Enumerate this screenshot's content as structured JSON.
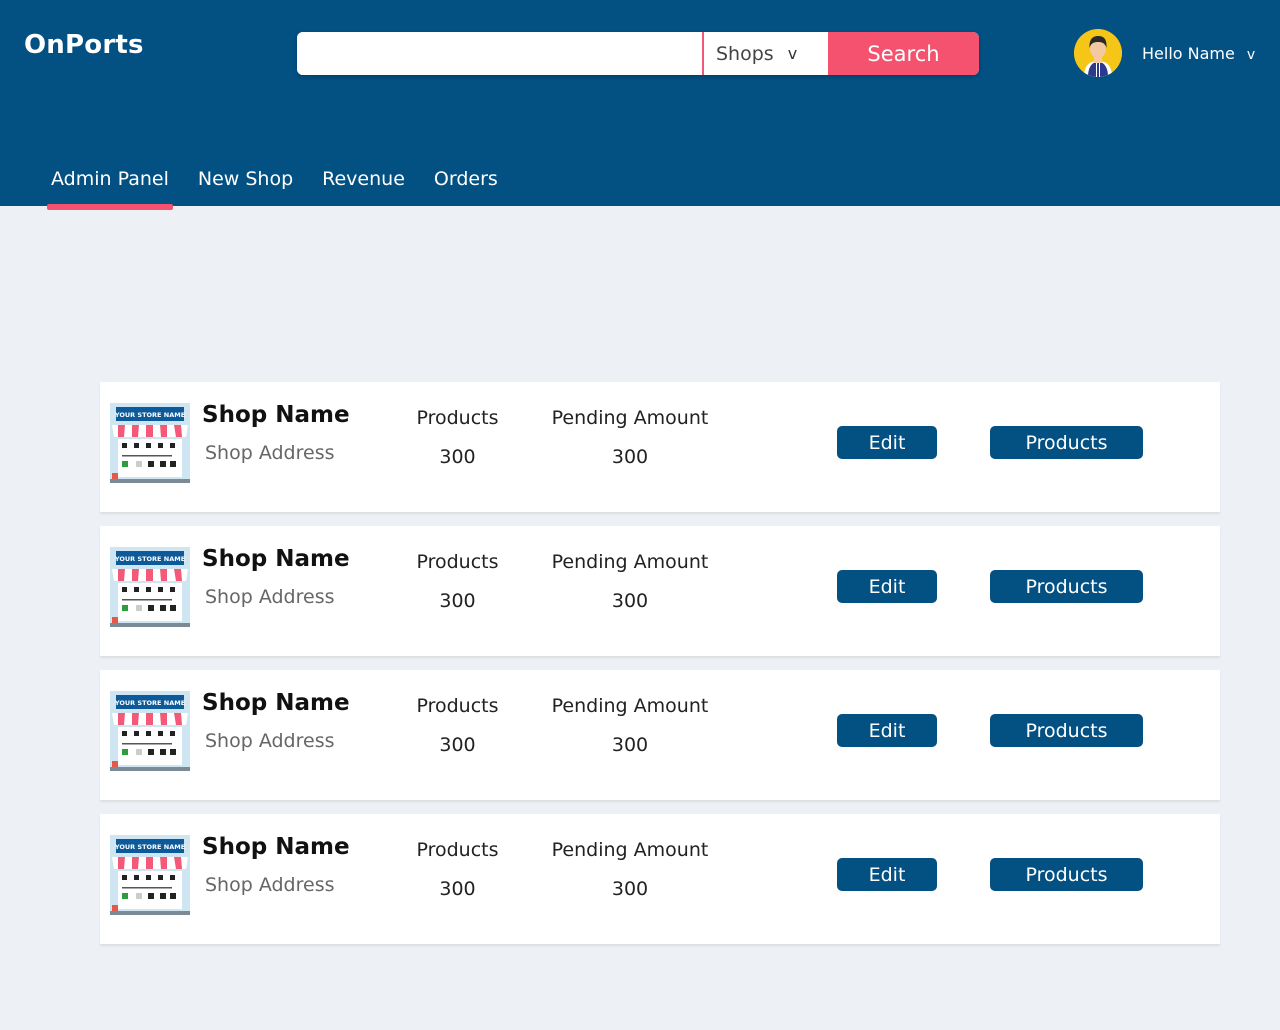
{
  "header": {
    "logo": "OnPorts",
    "search": {
      "value": "",
      "placeholder": "",
      "category": "Shops",
      "button": "Search"
    },
    "user": {
      "greeting": "Hello Name",
      "avatar_icon": "user-avatar-icon"
    },
    "chevron": "v"
  },
  "tabs": [
    {
      "label": "Admin Panel",
      "active": true
    },
    {
      "label": "New Shop",
      "active": false
    },
    {
      "label": "Revenue",
      "active": false
    },
    {
      "label": "Orders",
      "active": false
    }
  ],
  "shops": [
    {
      "name": "Shop Name",
      "address": "Shop Address",
      "products_label": "Products",
      "products": "300",
      "pending_label": "Pending Amount",
      "pending": "300",
      "edit_label": "Edit",
      "products_button": "Products",
      "thumb_sign": "YOUR STORE NAME"
    },
    {
      "name": "Shop Name",
      "address": "Shop Address",
      "products_label": "Products",
      "products": "300",
      "pending_label": "Pending Amount",
      "pending": "300",
      "edit_label": "Edit",
      "products_button": "Products",
      "thumb_sign": "YOUR STORE NAME"
    },
    {
      "name": "Shop Name",
      "address": "Shop Address",
      "products_label": "Products",
      "products": "300",
      "pending_label": "Pending Amount",
      "pending": "300",
      "edit_label": "Edit",
      "products_button": "Products",
      "thumb_sign": "YOUR STORE NAME"
    },
    {
      "name": "Shop Name",
      "address": "Shop Address",
      "products_label": "Products",
      "products": "300",
      "pending_label": "Pending Amount",
      "pending": "300",
      "edit_label": "Edit",
      "products_button": "Products",
      "thumb_sign": "YOUR STORE NAME"
    }
  ],
  "colors": {
    "header_bg": "#035083",
    "accent": "#f4526f",
    "page_bg": "#edf1f5",
    "button_bg": "#035083"
  }
}
